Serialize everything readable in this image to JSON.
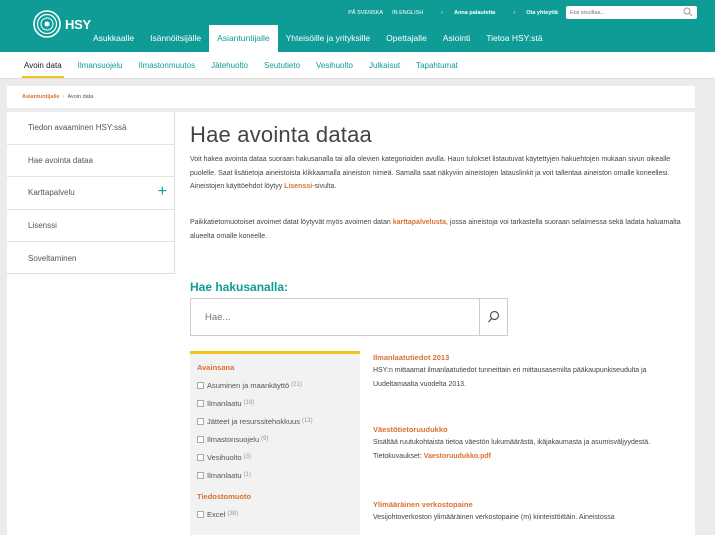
{
  "logo": {
    "text": "HSY"
  },
  "utility": {
    "lang_sv": "PÅ SVENSKA",
    "lang_en": "IN ENGLISH",
    "feedback": "Anna palautetta",
    "contact": "Ota yhteyttä",
    "search_placeholder": "Etsi sivuiltaa..."
  },
  "main_nav": [
    {
      "label": "Asukkaalle"
    },
    {
      "label": "Isännöitsijälle"
    },
    {
      "label": "Asiantuntijalle"
    },
    {
      "label": "Yhteisöille ja yrityksille"
    },
    {
      "label": "Opettajalle"
    },
    {
      "label": "Asiointi"
    },
    {
      "label": "Tietoa HSY:stä"
    }
  ],
  "sub_nav": [
    {
      "label": "Avoin data"
    },
    {
      "label": "Ilmansuojelu"
    },
    {
      "label": "Ilmastonmuutos"
    },
    {
      "label": "Jätehuolto"
    },
    {
      "label": "Seututieto"
    },
    {
      "label": "Vesihuolto"
    },
    {
      "label": "Julkaisut"
    },
    {
      "label": "Tapahtumat"
    }
  ],
  "breadcrumb": {
    "parent": "Asiantuntijalle",
    "current": "Avoin data"
  },
  "sidebar": [
    {
      "label": "Tiedon avaaminen HSY:ssä"
    },
    {
      "label": "Hae avointa dataa"
    },
    {
      "label": "Karttapalvelu"
    },
    {
      "label": "Lisenssi"
    },
    {
      "label": "Soveltaminen"
    }
  ],
  "page": {
    "title": "Hae avointa dataa",
    "p1_text": "Voit hakea avointa dataa suoraan hakusanalla tai alla olevien kategorioiden avulla. Haun tulokset listautuvat käytettyjen hakuehtojen mukaan sivun oikealle puolelle. Saat lisätietoja aineistoista klikkaamalla aineiston nimeä. Samalla saat näkyviin aineistojen latauslinkit ja voit tallentaa aineiston omalle koneellesi. Aineistojen käyttöehdot löytyy ",
    "p1_link": "Lisenssi",
    "p1_tail": "-sivulta.",
    "p2_text": "Paikkatietomuotoiset avoimet datat löytyvät myös avoimen datan ",
    "p2_link": "karttapalvelusta",
    "p2_tail": ", jossa aineistoja voi tarkastella suoraan selaimessa sekä ladata haluamalta alueelta omalle koneelle."
  },
  "search": {
    "title": "Hae hakusanalla:",
    "placeholder": "Hae..."
  },
  "filters": {
    "keyword_heading": "Avainsana",
    "keywords": [
      {
        "label": "Asuminen ja maankäyttö",
        "count": "(21)"
      },
      {
        "label": "Ilmanlaatu",
        "count": "(19)"
      },
      {
        "label": "Jätteet ja resurssitehokkuus",
        "count": "(13)"
      },
      {
        "label": "Ilmastonsuojelu",
        "count": "(9)"
      },
      {
        "label": "Vesihuolto",
        "count": "(3)"
      },
      {
        "label": "Ilmanlaatu",
        "count": "(1)"
      }
    ],
    "format_heading": "Tiedostomuoto",
    "formats": [
      {
        "label": "Excel",
        "count": "(38)"
      }
    ]
  },
  "results": [
    {
      "title": "Ilmanlaatutiedot 2013",
      "desc": "HSY:n mittaamat ilmanlaatutiedot tunneittain eri mittausasemilta pääkaupunkiseudulta ja Uudeltamaalta vuodelta 2013."
    },
    {
      "title": "Väestötietoruudukko",
      "desc": "Sisältää ruutukohtaista tietoa väestön lukumäärästä, ikäjakaumasta ja asumisväljyydestä. Tietokuvaukset: ",
      "link": "Vaestoruudukko.pdf"
    },
    {
      "title": "Ylimääräinen verkostopaine",
      "desc": "Vesijohtoverkoston ylimääräinen verkostopaine (m) kiinteistöittäin. Aineistossa"
    }
  ]
}
